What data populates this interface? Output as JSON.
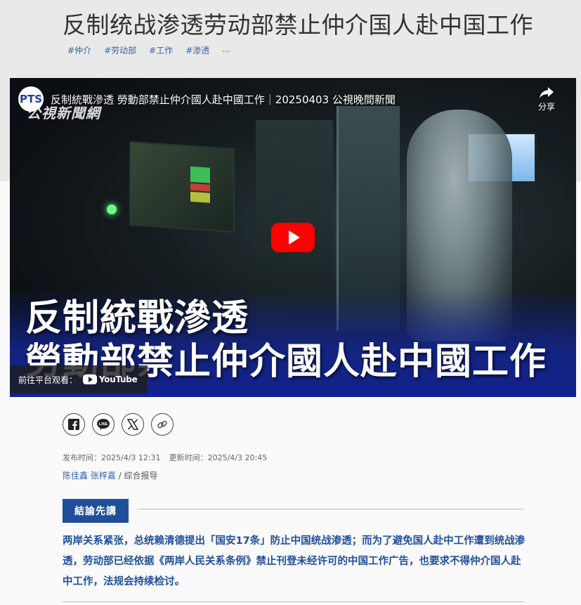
{
  "article": {
    "title": "反制统战渗透劳动部禁止仲介国人赴中国工作",
    "tags": [
      "#仲介",
      "#劳动部",
      "#工作",
      "#渗透",
      "..."
    ]
  },
  "video": {
    "channel_logo_text": "PTS",
    "title": "反制統戰滲透 勞動部禁止仲介國人赴中國工作｜20250403 公視晚間新聞",
    "watermark": "公視新聞網",
    "share_label": "分享",
    "overlay_line1": "反制統戰滲透",
    "overlay_line2": "勞動部禁止仲介國人赴中國工作",
    "watch_on_label": "前往平台观看：",
    "youtube_label": "YouTube"
  },
  "share_buttons": [
    {
      "icon": "facebook-icon"
    },
    {
      "icon": "line-icon",
      "text": "LINE"
    },
    {
      "icon": "x-icon"
    },
    {
      "icon": "link-icon"
    }
  ],
  "meta": {
    "published": "发布时间：2025/4/3 12:31",
    "updated": "更新时间：2025/4/3 20:45"
  },
  "byline": {
    "authors": "陈佳鑫 张梓嘉",
    "suffix": " / 综合报导"
  },
  "summary": {
    "heading": "結論先講",
    "text": "两岸关系紧张，总统赖清德提出「国安17条」防止中国统战渗透；而为了避免国人赴中工作遭到统战渗透，劳动部已经依据《两岸人民关系条例》禁止刊登未经许可的中国工作广告，也要求不得仲介国人赴中工作，法规会持续检讨。"
  },
  "colors": {
    "accent": "#1f4f9a",
    "tag_link": "#3a64a8",
    "header_band": "#e9e9e9",
    "youtube_red": "#ff0000"
  }
}
